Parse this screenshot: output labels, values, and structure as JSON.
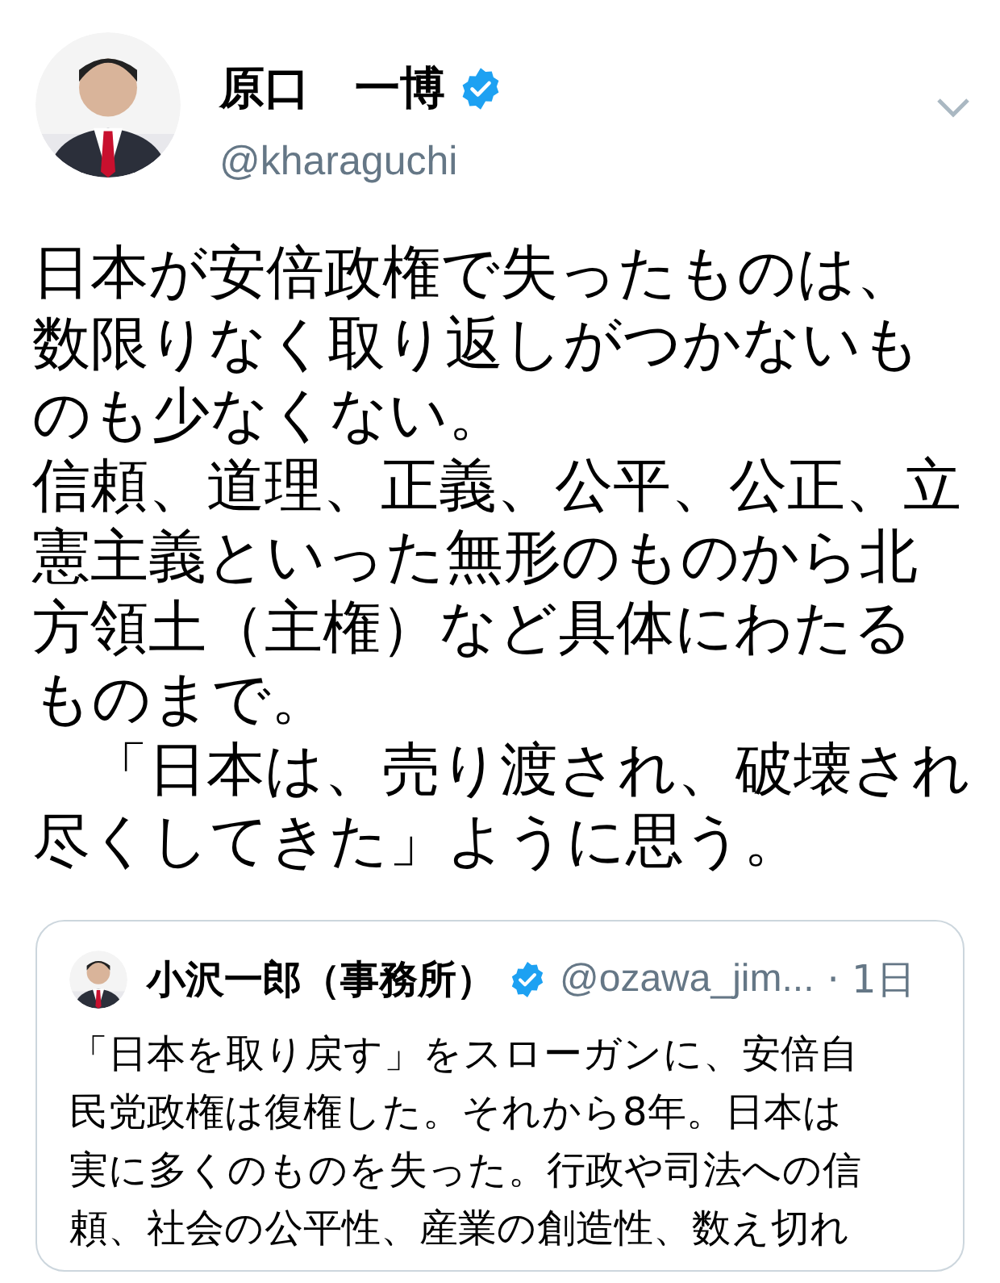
{
  "tweet": {
    "author": {
      "name": "原口　一博",
      "verified": true,
      "handle": "@kharaguchi"
    },
    "paragraphs": [
      "日本が安倍政権で失ったものは、数限りなく取り返しがつかないものも少なくない。",
      "信頼、道理、正義、公平、公正、立憲主義といった無形のものから北方領土（主権）など具体にわたるものまで。",
      "　「日本は、売り渡され、破壊され尽くしてきた」ように思う。"
    ],
    "quoted": {
      "author": {
        "name": "小沢一郎（事務所）",
        "verified": true,
        "handle": "@ozawa_jim..."
      },
      "time": "· 1日",
      "text": "「日本を取り戻す」をスローガンに、安倍自民党政権は復権した。それから8年。日本は実に多くのものを失った。行政や司法への信頼、社会の公平性、産業の創造性、数え切れ"
    }
  }
}
